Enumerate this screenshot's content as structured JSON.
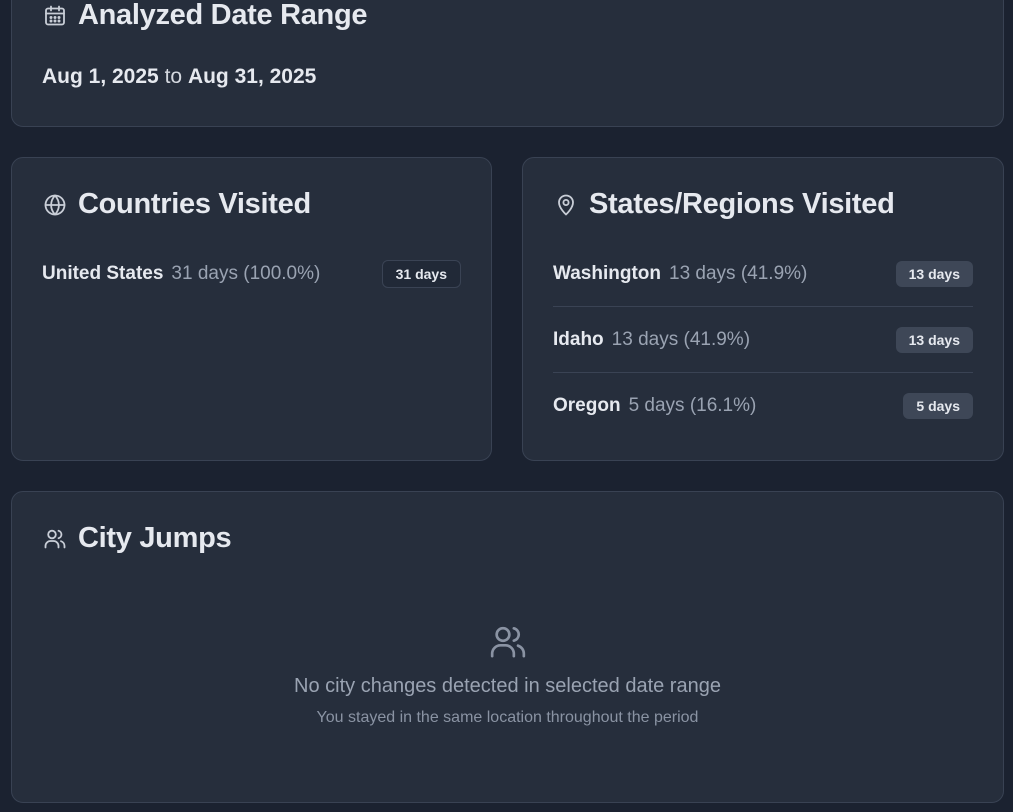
{
  "date_range": {
    "title": "Analyzed Date Range",
    "icon": "calendar-icon",
    "start": "Aug 1, 2025",
    "connector": "to",
    "end": "Aug 31, 2025"
  },
  "countries": {
    "title": "Countries Visited",
    "icon": "globe-icon",
    "items": [
      {
        "name": "United States",
        "stat": "31 days (100.0%)",
        "badge": "31 days"
      }
    ]
  },
  "states": {
    "title": "States/Regions Visited",
    "icon": "map-pin-icon",
    "items": [
      {
        "name": "Washington",
        "stat": "13 days (41.9%)",
        "badge": "13 days"
      },
      {
        "name": "Idaho",
        "stat": "13 days (41.9%)",
        "badge": "13 days"
      },
      {
        "name": "Oregon",
        "stat": "5 days (16.1%)",
        "badge": "5 days"
      }
    ]
  },
  "city_jumps": {
    "title": "City Jumps",
    "icon": "users-icon",
    "empty_icon": "users-icon",
    "empty_title": "No city changes detected in selected date range",
    "empty_subtitle": "You stayed in the same location throughout the period"
  }
}
